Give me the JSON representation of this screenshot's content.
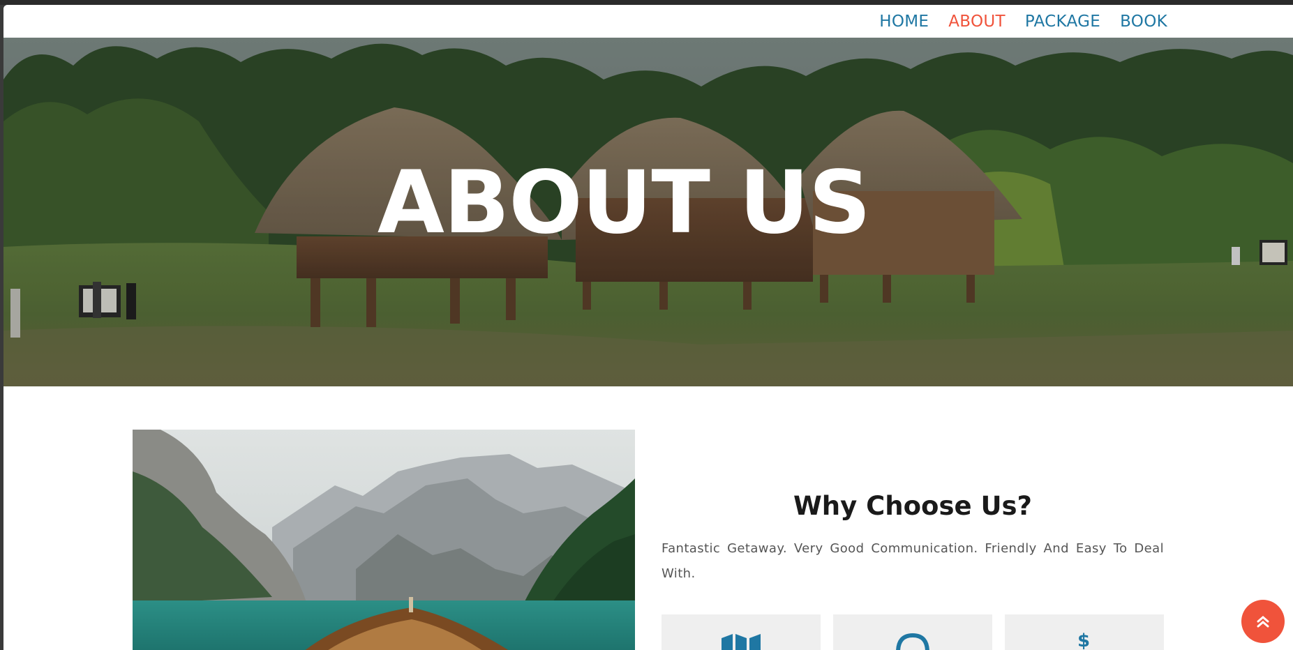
{
  "nav": {
    "items": [
      {
        "label": "HOME",
        "active": false
      },
      {
        "label": "ABOUT",
        "active": true
      },
      {
        "label": "PACKAGE",
        "active": false
      },
      {
        "label": "BOOK",
        "active": false
      }
    ]
  },
  "hero": {
    "title": "ABOUT US"
  },
  "why": {
    "title": "Why Choose Us?",
    "text": "Fantastic Getaway. Very Good Communication. Friendly And Easy To Deal With."
  },
  "features": [
    {
      "icon": "map-icon"
    },
    {
      "icon": "headset-icon"
    },
    {
      "icon": "dollar-hand-icon"
    }
  ],
  "colors": {
    "accent": "#f0533b",
    "primary": "#1f77a3",
    "feature_bg": "#efefef"
  },
  "scroll_top": {
    "icon": "double-chevron-up-icon"
  }
}
